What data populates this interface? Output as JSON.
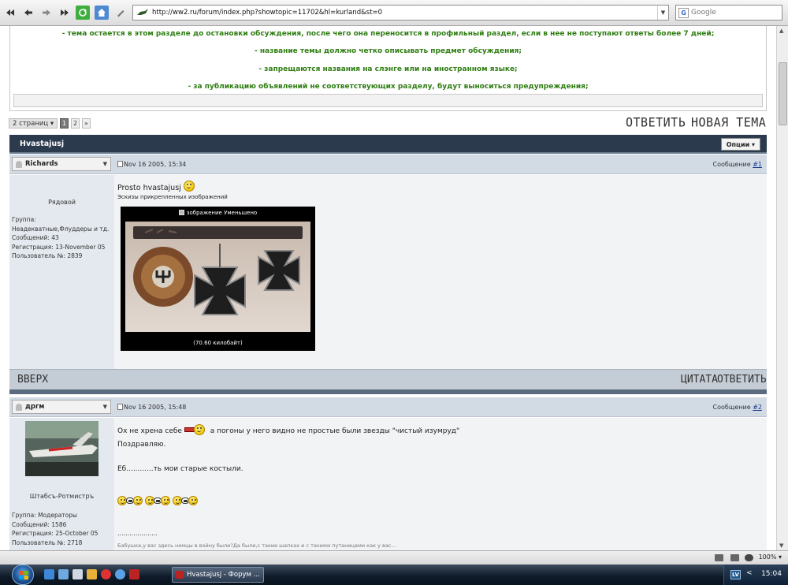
{
  "browser": {
    "url": "http://ww2.ru/forum/index.php?showtopic=11702&hl=kurland&st=0",
    "search_placeholder": "Google",
    "search_engine_letter": "G",
    "zoom": "100%"
  },
  "rules": [
    "- тема остается в этом разделе до остановки обсуждения, после чего она переносится в профильный раздел, если в нее не поступают ответы более 7 дней;",
    "- название темы должно четко описывать предмет обсуждения;",
    "- запрещаются названия на слэнге или на иностранном языке;",
    "- за публикацию объявлений не соответствующих разделу, будут выноситься предупреждения;"
  ],
  "pagination": {
    "label": "2 страниц",
    "pages": [
      "1",
      "2"
    ],
    "current": "1",
    "next": "»"
  },
  "actions": {
    "reply": "ОТВЕТИТЬ",
    "new_topic": "НОВАЯ ТЕМА",
    "top": "ВВЕРХ",
    "quote": "ЦИТАТА"
  },
  "topic": {
    "title": "Hvastajusj",
    "options": "Опции"
  },
  "posts": [
    {
      "user": "Richards",
      "date": "Nov 16 2005, 15:34",
      "num_label": "Сообщение ",
      "num": "#1",
      "rank": "Рядовой",
      "info": [
        "Группа:",
        "Неадекватные,Флуддеры и тд.",
        "Сообщений: 43",
        "Регистрация: 13-November 05",
        "Пользователь №: 2839"
      ],
      "text": "Prosto hvastajusj",
      "attach_label": "Эскизы прикрепленных изображений",
      "image_caption": "зображение Уменьшено",
      "image_size": "(70.60 килобайт)"
    },
    {
      "user": "дргм",
      "date": "Nov 16 2005, 15:48",
      "num_label": "Сообщение ",
      "num": "#2",
      "rank": "Штабсъ-Ротмистръ",
      "info": [
        "Группа: Модераторы",
        "Сообщений: 1586",
        "Регистрация: 25-October 05",
        "Пользователь №: 2718"
      ],
      "line1_a": "Ох не хрена себе",
      "line1_b": "а погоны у него видно не простые были звезды \"чистый изумруд\"",
      "line2": "Поздравляю.",
      "line3": "Еб............ть мои старые костыли.",
      "line4": "....................",
      "line5": "Бабушка,у вас здесь немцы в войну были?Да были,с такие шапках и с такими путаницами как у вас..."
    }
  ],
  "taskbar": {
    "window_title": "Hvastajusj - Форум ...",
    "lang": "LV",
    "arrow": "<",
    "clock": "15:04"
  }
}
